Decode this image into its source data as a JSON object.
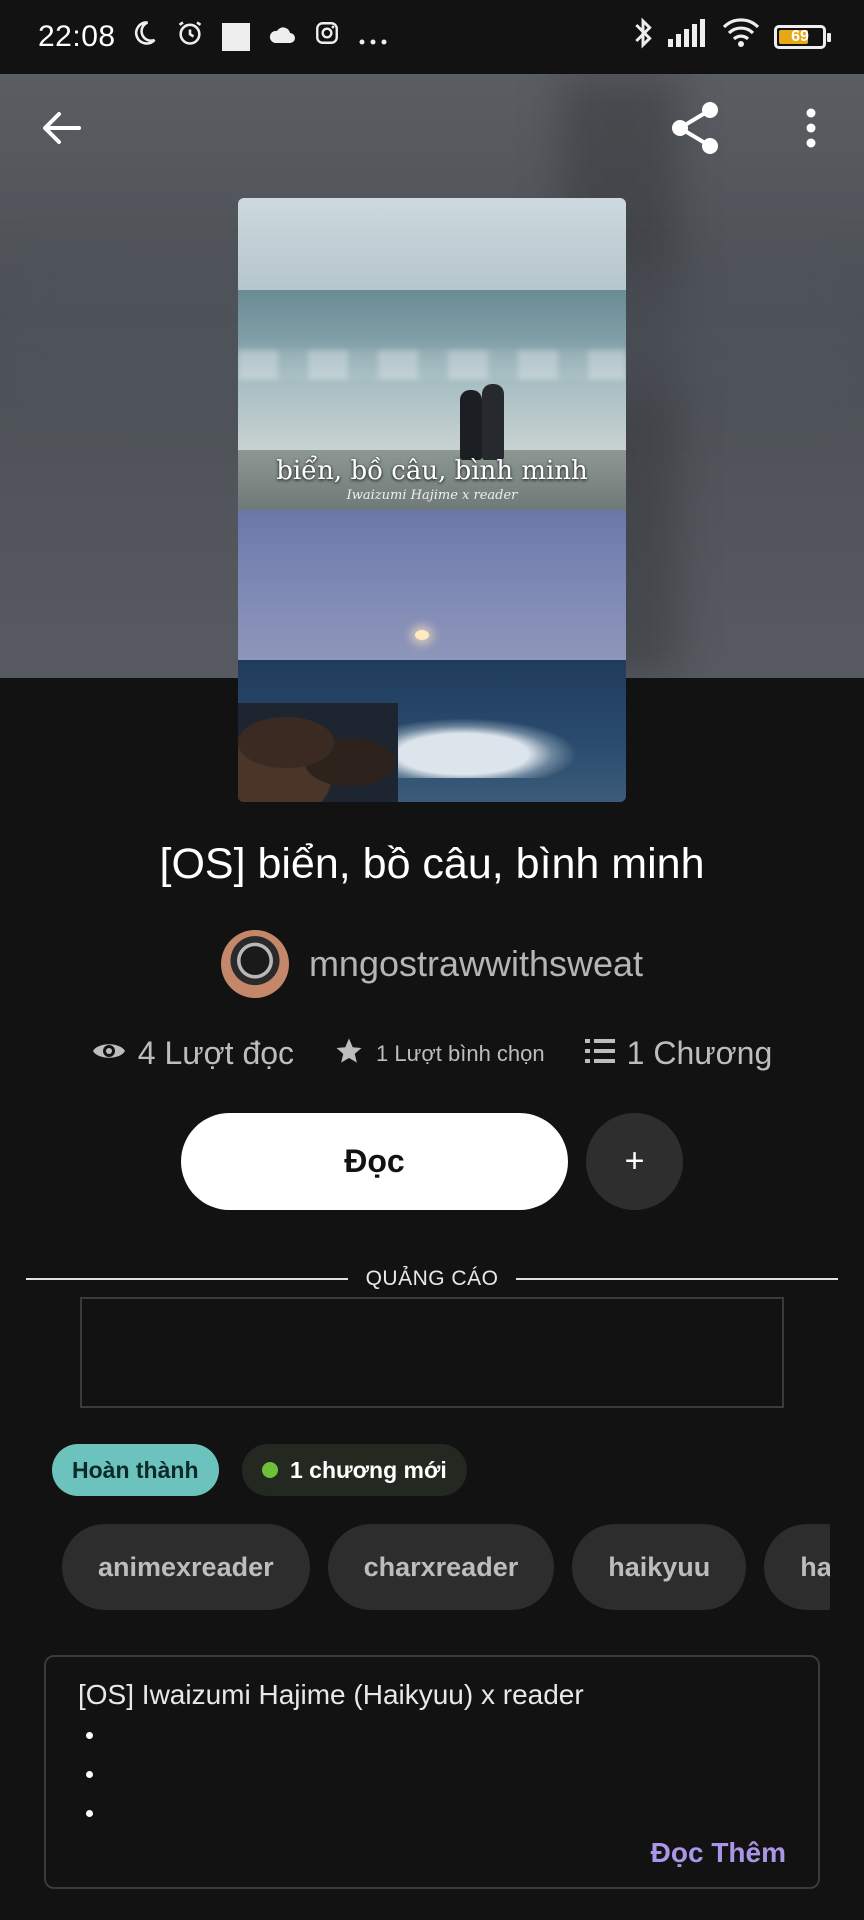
{
  "status_bar": {
    "time": "22:08",
    "battery_level": "69",
    "icons_left": [
      "moon-icon",
      "alarm-icon",
      "square-icon",
      "cloud-icon",
      "instagram-icon",
      "more-dots-icon"
    ],
    "icons_right": [
      "bluetooth-icon",
      "signal-icon",
      "wifi-icon",
      "battery-icon"
    ]
  },
  "cover": {
    "title_overlay": "biển, bồ câu, bình minh",
    "subtitle_overlay": "Iwaizumi Hajime x reader"
  },
  "story": {
    "title": "[OS] biển, bồ câu, bình minh",
    "author": "mngostrawwithsweat"
  },
  "stats": {
    "reads": "4 Lượt đọc",
    "votes": "1 Lượt bình chọn",
    "chapters": "1 Chương"
  },
  "actions": {
    "read_label": "Đọc",
    "add_label": "+"
  },
  "ad": {
    "label": "QUẢNG CÁO"
  },
  "badges": {
    "complete": "Hoàn thành",
    "new_chapters": "1 chương mới"
  },
  "tags": [
    "animexreader",
    "charxreader",
    "haikyuu",
    "ha"
  ],
  "description": {
    "text": "[OS] Iwaizumi Hajime (Haikyuu) x reader",
    "more_label": "Đọc Thêm"
  },
  "colors": {
    "complete_badge": "#6cc3bd",
    "new_dot": "#6fbf3a",
    "read_more": "#a996e8"
  }
}
